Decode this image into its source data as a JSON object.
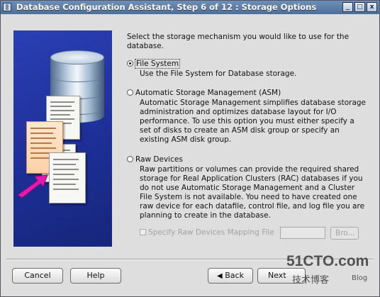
{
  "window": {
    "title": "Database Configuration Assistant, Step 6 of 12 : Storage Options",
    "controls": {
      "minimize": "_",
      "maximize": "□",
      "close": "x"
    }
  },
  "intro": "Select the storage mechanism you would like to use for the database.",
  "options": [
    {
      "label": "File System",
      "selected": true,
      "description": "Use the File System for Database storage."
    },
    {
      "label": "Automatic Storage Management (ASM)",
      "selected": false,
      "description": "Automatic Storage Management simplifies database storage administration and optimizes database layout for I/O performance. To use this option you must either specify a set of disks to create an ASM disk group or specify an existing ASM disk group."
    },
    {
      "label": "Raw Devices",
      "selected": false,
      "description": "Raw partitions or volumes can provide the required shared storage for Real Application Clusters (RAC) databases if you do not use Automatic Storage Management and a Cluster File System is not available.  You need to have created one raw device for each datafile, control file, and log file you are planning to create in the database."
    }
  ],
  "raw_mapping": {
    "checkbox_label": "Specify Raw Devices Mapping File",
    "checked": false,
    "enabled": false,
    "input_value": "",
    "browse_label": "Bro..."
  },
  "footer": {
    "cancel": "Cancel",
    "help": "Help",
    "back": "Back",
    "next": "Next"
  },
  "watermark": {
    "site": "51CTO.com",
    "tagline": "技术博客",
    "suffix": "Blog"
  },
  "icons": [
    "app-window-icon",
    "database-cylinder-icon",
    "document-icon",
    "arrow-icon"
  ]
}
